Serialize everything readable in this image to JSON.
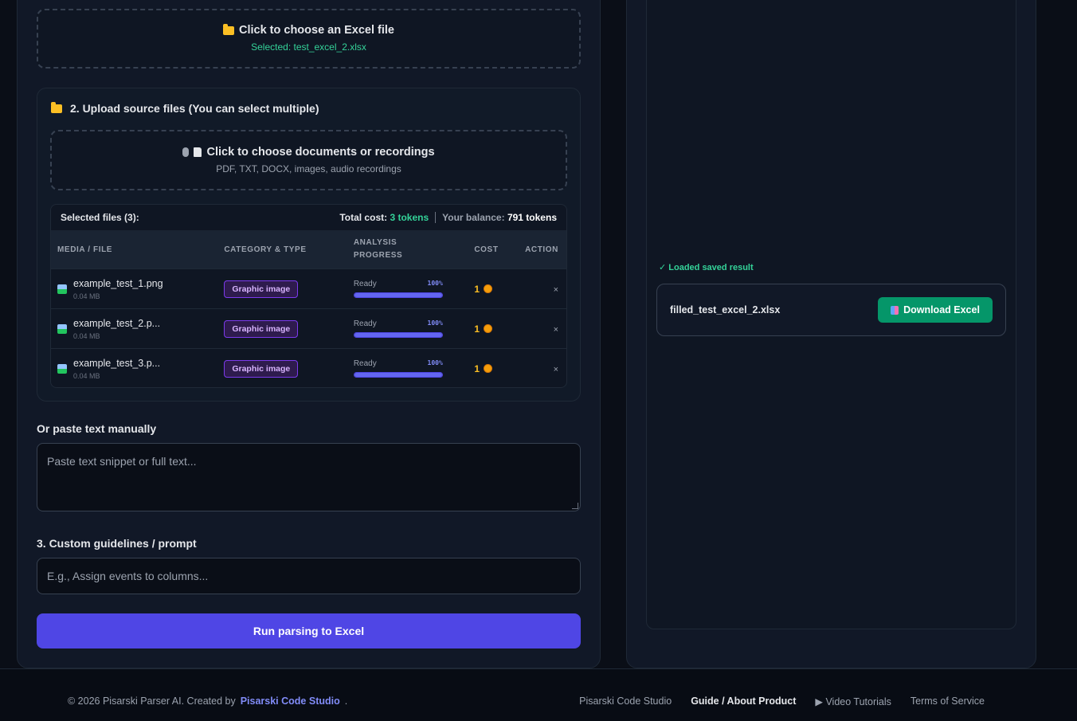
{
  "excel_upload": {
    "title": "Click to choose an Excel file",
    "selected": "Selected: test_excel_2.xlsx"
  },
  "source_upload": {
    "heading": "2. Upload source files (You can select multiple)",
    "title": "Click to choose documents or recordings",
    "subtitle": "PDF, TXT, DOCX, images, audio recordings"
  },
  "files": {
    "selected_label": "Selected files (3):",
    "total_cost_label": "Total cost:",
    "total_cost_value": "3 tokens",
    "balance_label": "Your balance:",
    "balance_value": "791 tokens",
    "columns": [
      "MEDIA / FILE",
      "CATEGORY & TYPE",
      "ANALYSIS",
      "PROGRESS",
      "COST",
      "ACTION"
    ],
    "rows": [
      {
        "name": "example_test_1.png",
        "size": "0.04 MB",
        "category": "Graphic image",
        "status": "Ready",
        "progress": "100%",
        "cost": "1",
        "action": "×"
      },
      {
        "name": "example_test_2.p...",
        "size": "0.04 MB",
        "category": "Graphic image",
        "status": "Ready",
        "progress": "100%",
        "cost": "1",
        "action": "×"
      },
      {
        "name": "example_test_3.p...",
        "size": "0.04 MB",
        "category": "Graphic image",
        "status": "Ready",
        "progress": "100%",
        "cost": "1",
        "action": "×"
      }
    ]
  },
  "manual_text": {
    "label": "Or paste text manually",
    "placeholder": "Paste text snippet or full text..."
  },
  "prompt": {
    "label": "3. Custom guidelines / prompt",
    "placeholder": "E.g., Assign events to columns..."
  },
  "run_button": "Run parsing to Excel",
  "result": {
    "loaded": "✓ Loaded saved result",
    "filename": "filled_test_excel_2.xlsx",
    "download": "Download Excel"
  },
  "footer": {
    "copyright": "© 2026 Pisarski Parser AI. Created by",
    "brand": "Pisarski Code Studio",
    "dot": ".",
    "links": [
      "Pisarski Code Studio",
      "Guide / About Product",
      "▶ Video Tutorials",
      "Terms of Service"
    ]
  },
  "colors": {
    "accent": "#4f46e5",
    "success": "#059669",
    "background": "#0a0e17"
  }
}
